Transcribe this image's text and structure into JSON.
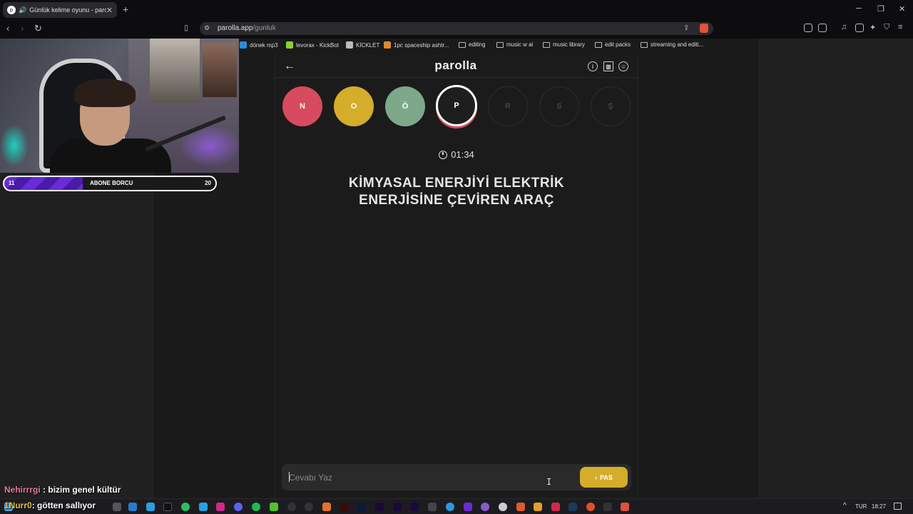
{
  "browser": {
    "tab_title": "Günlük kelime oyunu - paroll",
    "url_host": "parolla.app",
    "url_path": "/gunluk",
    "bookmarks": [
      {
        "label": "dönek mp3",
        "color": "#2b8ae0"
      },
      {
        "label": "levorax - KickBot",
        "color": "#8ad22a"
      },
      {
        "label": "KİCKLET",
        "color": "#bbbbbb"
      },
      {
        "label": "1pc spaceship ashtr...",
        "color": "#e08a2b"
      },
      {
        "label": "editing",
        "folder": true
      },
      {
        "label": "music w ai",
        "folder": true
      },
      {
        "label": "music library",
        "folder": true
      },
      {
        "label": "edit packs",
        "folder": true
      },
      {
        "label": "streaming and editi...",
        "folder": true
      }
    ]
  },
  "stream": {
    "subbar_left": "11",
    "subbar_label": "ABONE BORCU",
    "subbar_right": "20",
    "chat": [
      {
        "user": "Nehirrrgi",
        "user_color": "#e87a9a",
        "sep": " : ",
        "message": "bizim genel kültür"
      },
      {
        "user": "1Nurr0",
        "user_color": "#e0c040",
        "sep": ": ",
        "message": "götten sallıyor"
      }
    ]
  },
  "game": {
    "logo": "parolla",
    "letters": [
      {
        "letter": "N",
        "state": "wrong"
      },
      {
        "letter": "O",
        "state": "passed"
      },
      {
        "letter": "Ö",
        "state": "correct"
      },
      {
        "letter": "P",
        "state": "current"
      },
      {
        "letter": "R",
        "state": "pending"
      },
      {
        "letter": "S",
        "state": "pending"
      },
      {
        "letter": "Ş",
        "state": "pending"
      }
    ],
    "timer": "01:34",
    "question_line1": "KİMYASAL ENERJİYİ ELEKTRİK",
    "question_line2": "ENERJİSİNE ÇEVİREN ARAÇ",
    "answer_placeholder": "Cevabı Yaz",
    "answer_value": "",
    "pass_label": "PAS",
    "colors": {
      "wrong": "#d84a5e",
      "passed": "#d4ad2a",
      "correct": "#7ea88a"
    }
  },
  "taskbar": {
    "lang": "TUR",
    "time": "18:27"
  }
}
